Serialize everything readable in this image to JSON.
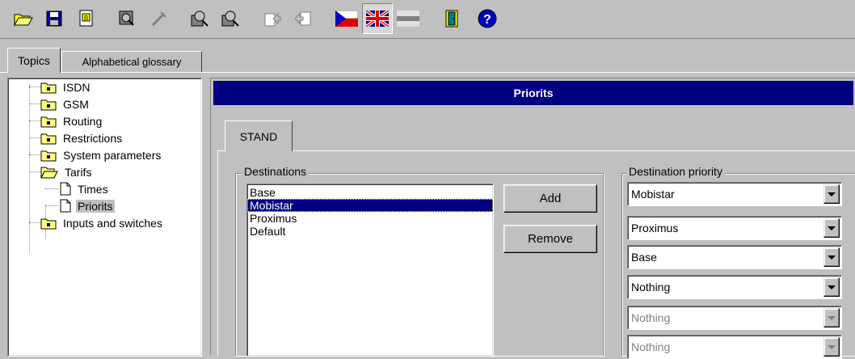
{
  "toolbar": {
    "buttons": [
      {
        "icon": "open-folder-icon"
      },
      {
        "icon": "save-disk-icon"
      },
      {
        "icon": "export-document-icon"
      },
      {
        "icon": "search-device-icon"
      },
      {
        "icon": "disconnect-icon"
      },
      {
        "icon": "read-device-icon"
      },
      {
        "icon": "write-device-icon"
      },
      {
        "icon": "upload-icon"
      },
      {
        "icon": "download-icon"
      },
      {
        "icon": "czech-flag-icon"
      },
      {
        "icon": "uk-flag-icon"
      },
      {
        "icon": "language-blank-icon"
      },
      {
        "icon": "exit-door-icon"
      },
      {
        "icon": "help-icon"
      }
    ]
  },
  "tabs": {
    "topics": "Topics",
    "glossary": "Alphabetical glossary"
  },
  "tree": {
    "items": [
      {
        "label": "ISDN",
        "icon": "folder-icon"
      },
      {
        "label": "GSM",
        "icon": "folder-icon"
      },
      {
        "label": "Routing",
        "icon": "folder-icon"
      },
      {
        "label": "Restrictions",
        "icon": "folder-icon"
      },
      {
        "label": "System parameters",
        "icon": "folder-icon"
      },
      {
        "label": "Tarifs",
        "icon": "open-folder-icon"
      },
      {
        "label": "Times",
        "icon": "page-icon"
      },
      {
        "label": "Priorits",
        "icon": "page-icon"
      },
      {
        "label": "Inputs and switches",
        "icon": "folder-icon"
      }
    ],
    "selected": "Priorits"
  },
  "panel": {
    "title": "Priorits",
    "title_color": "#000080",
    "inner_tab": "STAND"
  },
  "destinations": {
    "legend": "Destinations",
    "items": [
      "Base",
      "Mobistar",
      "Proximus",
      "Default"
    ],
    "selected": "Mobistar",
    "add_label": "Add",
    "remove_label": "Remove"
  },
  "priority": {
    "legend": "Destination priority",
    "combos": [
      {
        "value": "Mobistar",
        "enabled": true
      },
      {
        "value": "Proximus",
        "enabled": true
      },
      {
        "value": "Base",
        "enabled": true
      },
      {
        "value": "Nothing",
        "enabled": true
      },
      {
        "value": "Nothing",
        "enabled": false
      },
      {
        "value": "Nothing",
        "enabled": false
      }
    ]
  }
}
